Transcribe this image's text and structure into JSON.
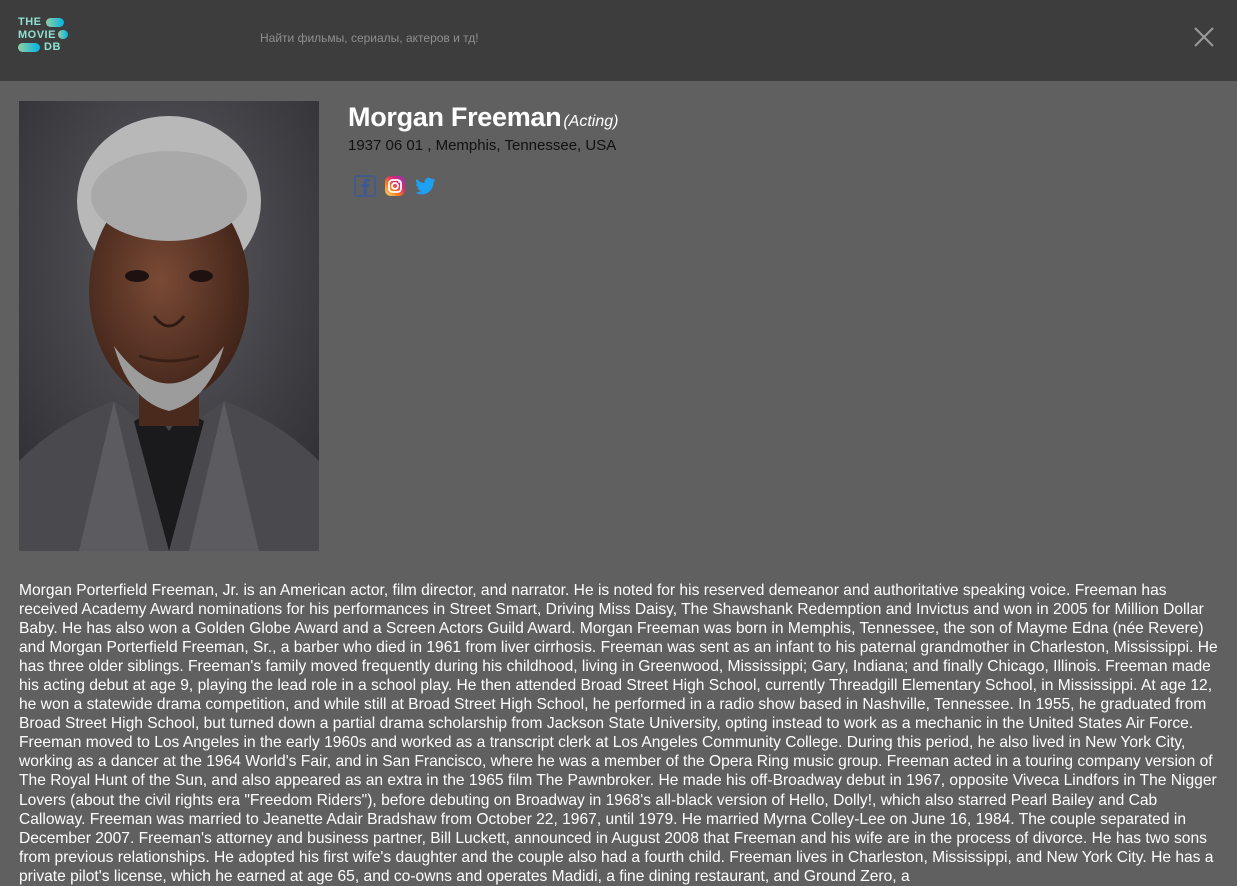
{
  "header": {
    "logo": {
      "line1": "THE",
      "line2": "MOVIE",
      "line3": "DB"
    },
    "search": {
      "placeholder": "Найти фильмы, сериалы, актеров и тд!",
      "value": ""
    },
    "close_icon": "close-icon"
  },
  "person": {
    "name": "Morgan Freeman",
    "role": "(Acting)",
    "birth": "1937 06 01 , Memphis, Tennessee, USA",
    "socials": [
      {
        "icon": "facebook-icon",
        "color": "#3b5998"
      },
      {
        "icon": "instagram-icon",
        "color": "#e1306c"
      },
      {
        "icon": "twitter-icon",
        "color": "#1da1f2"
      }
    ],
    "biography": "Morgan Porterfield Freeman, Jr. is an American actor, film director, and narrator. He is noted for his reserved demeanor and authoritative speaking voice. Freeman has received Academy Award nominations for his performances in Street Smart, Driving Miss Daisy, The Shawshank Redemption and Invictus and won in 2005 for Million Dollar Baby. He has also won a Golden Globe Award and a Screen Actors Guild Award. Morgan Freeman was born in Memphis, Tennessee, the son of Mayme Edna (née Revere) and Morgan Porterfield Freeman, Sr., a barber who died in 1961 from liver cirrhosis. Freeman was sent as an infant to his paternal grandmother in Charleston, Mississippi. He has three older siblings. Freeman's family moved frequently during his childhood, living in Greenwood, Mississippi; Gary, Indiana; and finally Chicago, Illinois. Freeman made his acting debut at age 9, playing the lead role in a school play. He then attended Broad Street High School, currently Threadgill Elementary School, in Mississippi. At age 12, he won a statewide drama competition, and while still at Broad Street High School, he performed in a radio show based in Nashville, Tennessee. In 1955, he graduated from Broad Street High School, but turned down a partial drama scholarship from Jackson State University, opting instead to work as a mechanic in the United States Air Force. Freeman moved to Los Angeles in the early 1960s and worked as a transcript clerk at Los Angeles Community College. During this period, he also lived in New York City, working as a dancer at the 1964 World's Fair, and in San Francisco, where he was a member of the Opera Ring music group. Freeman acted in a touring company version of The Royal Hunt of the Sun, and also appeared as an extra in the 1965 film The Pawnbroker. He made his off-Broadway debut in 1967, opposite Viveca Lindfors in The Nigger Lovers (about the civil rights era \"Freedom Riders\"), before debuting on Broadway in 1968's all-black version of Hello, Dolly!, which also starred Pearl Bailey and Cab Calloway. Freeman was married to Jeanette Adair Bradshaw from October 22, 1967, until 1979. He married Myrna Colley-Lee on June 16, 1984. The couple separated in December 2007. Freeman's attorney and business partner, Bill Luckett, announced in August 2008 that Freeman and his wife are in the process of divorce. He has two sons from previous relationships. He adopted his first wife's daughter and the couple also had a fourth child. Freeman lives in Charleston, Mississippi, and New York City. He has a private pilot's license, which he earned at age 65, and co-owns and operates Madidi, a fine dining restaurant, and Ground Zero, a"
  }
}
